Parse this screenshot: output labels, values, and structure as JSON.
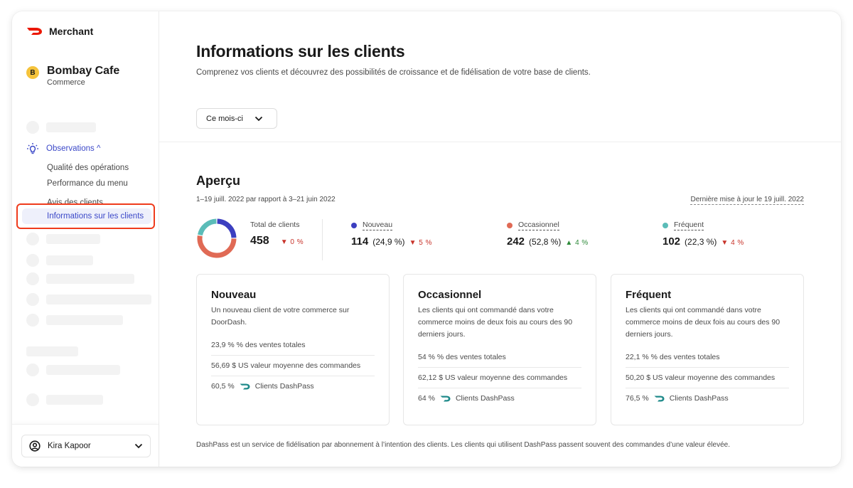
{
  "brand": {
    "name": "Merchant",
    "logo_icon": "doordash-logo-icon",
    "color": "#eb1700"
  },
  "store": {
    "initial": "B",
    "name": "Bombay Cafe",
    "type": "Commerce"
  },
  "sidebar": {
    "group": {
      "label": "Observations ^",
      "icon": "lightbulb-icon"
    },
    "sub_items": [
      {
        "label": "Qualité des opérations"
      },
      {
        "label": "Performance du menu"
      },
      {
        "label": "Avis des clients"
      }
    ],
    "active_item": {
      "label": "Informations sur les clients"
    },
    "user": {
      "name": "Kira Kapoor",
      "icon": "user-circle-icon"
    }
  },
  "header": {
    "title": "Informations sur les clients",
    "subtitle": "Comprenez vos clients et découvrez des possibilités de croissance et de fidélisation de votre base de clients.",
    "period_select": {
      "value": "Ce mois-ci"
    }
  },
  "overview": {
    "title": "Aperçu",
    "range": "1–19 juill. 2022 par rapport à 3–21 juin 2022",
    "last_update": "Dernière mise à jour le 19 juill. 2022",
    "total": {
      "label": "Total de clients",
      "value": "458",
      "delta": "▼ 0 %",
      "direction": "down"
    },
    "segments": [
      {
        "key": "nouveau",
        "label": "Nouveau",
        "value": "114",
        "pct": "(24,9 %)",
        "delta": "▼ 5 %",
        "direction": "down",
        "color": "#3c3fc0"
      },
      {
        "key": "occasionnel",
        "label": "Occasionnel",
        "value": "242",
        "pct": "(52,8 %)",
        "delta": "▲ 4 %",
        "direction": "up",
        "color": "#e06a55"
      },
      {
        "key": "frequent",
        "label": "Fréquent",
        "value": "102",
        "pct": "(22,3 %)",
        "delta": "▼ 4 %",
        "direction": "down",
        "color": "#5bbcb8"
      }
    ]
  },
  "chart_data": {
    "type": "pie",
    "title": "Total de clients",
    "categories": [
      "Nouveau",
      "Occasionnel",
      "Fréquent"
    ],
    "values": [
      114,
      242,
      102
    ],
    "colors": [
      "#3c3fc0",
      "#e06a55",
      "#5bbcb8"
    ],
    "total": 458
  },
  "cards": [
    {
      "title": "Nouveau",
      "description": "Un nouveau client de votre commerce sur DoorDash.",
      "sales_share": "23,9 % % des ventes totales",
      "avg_order": "56,69 $ US valeur moyenne des commandes",
      "dashpass_pct": "60,5 %",
      "dashpass_label": "Clients DashPass"
    },
    {
      "title": "Occasionnel",
      "description": "Les clients qui ont commandé dans votre commerce moins de deux fois au cours des 90 derniers jours.",
      "sales_share": "54 % % des ventes totales",
      "avg_order": "62,12 $ US valeur moyenne des commandes",
      "dashpass_pct": "64 %",
      "dashpass_label": "Clients DashPass"
    },
    {
      "title": "Fréquent",
      "description": "Les clients qui ont commandé dans votre commerce moins de deux fois au cours des 90 derniers jours.",
      "sales_share": "22,1 % % des ventes totales",
      "avg_order": "50,20 $ US valeur moyenne des commandes",
      "dashpass_pct": "76,5 %",
      "dashpass_label": "Clients DashPass"
    }
  ],
  "footnote": "DashPass est un service de fidélisation par abonnement à l’intention des clients. Les clients qui utilisent DashPass passent souvent des commandes d’une valeur élevée."
}
